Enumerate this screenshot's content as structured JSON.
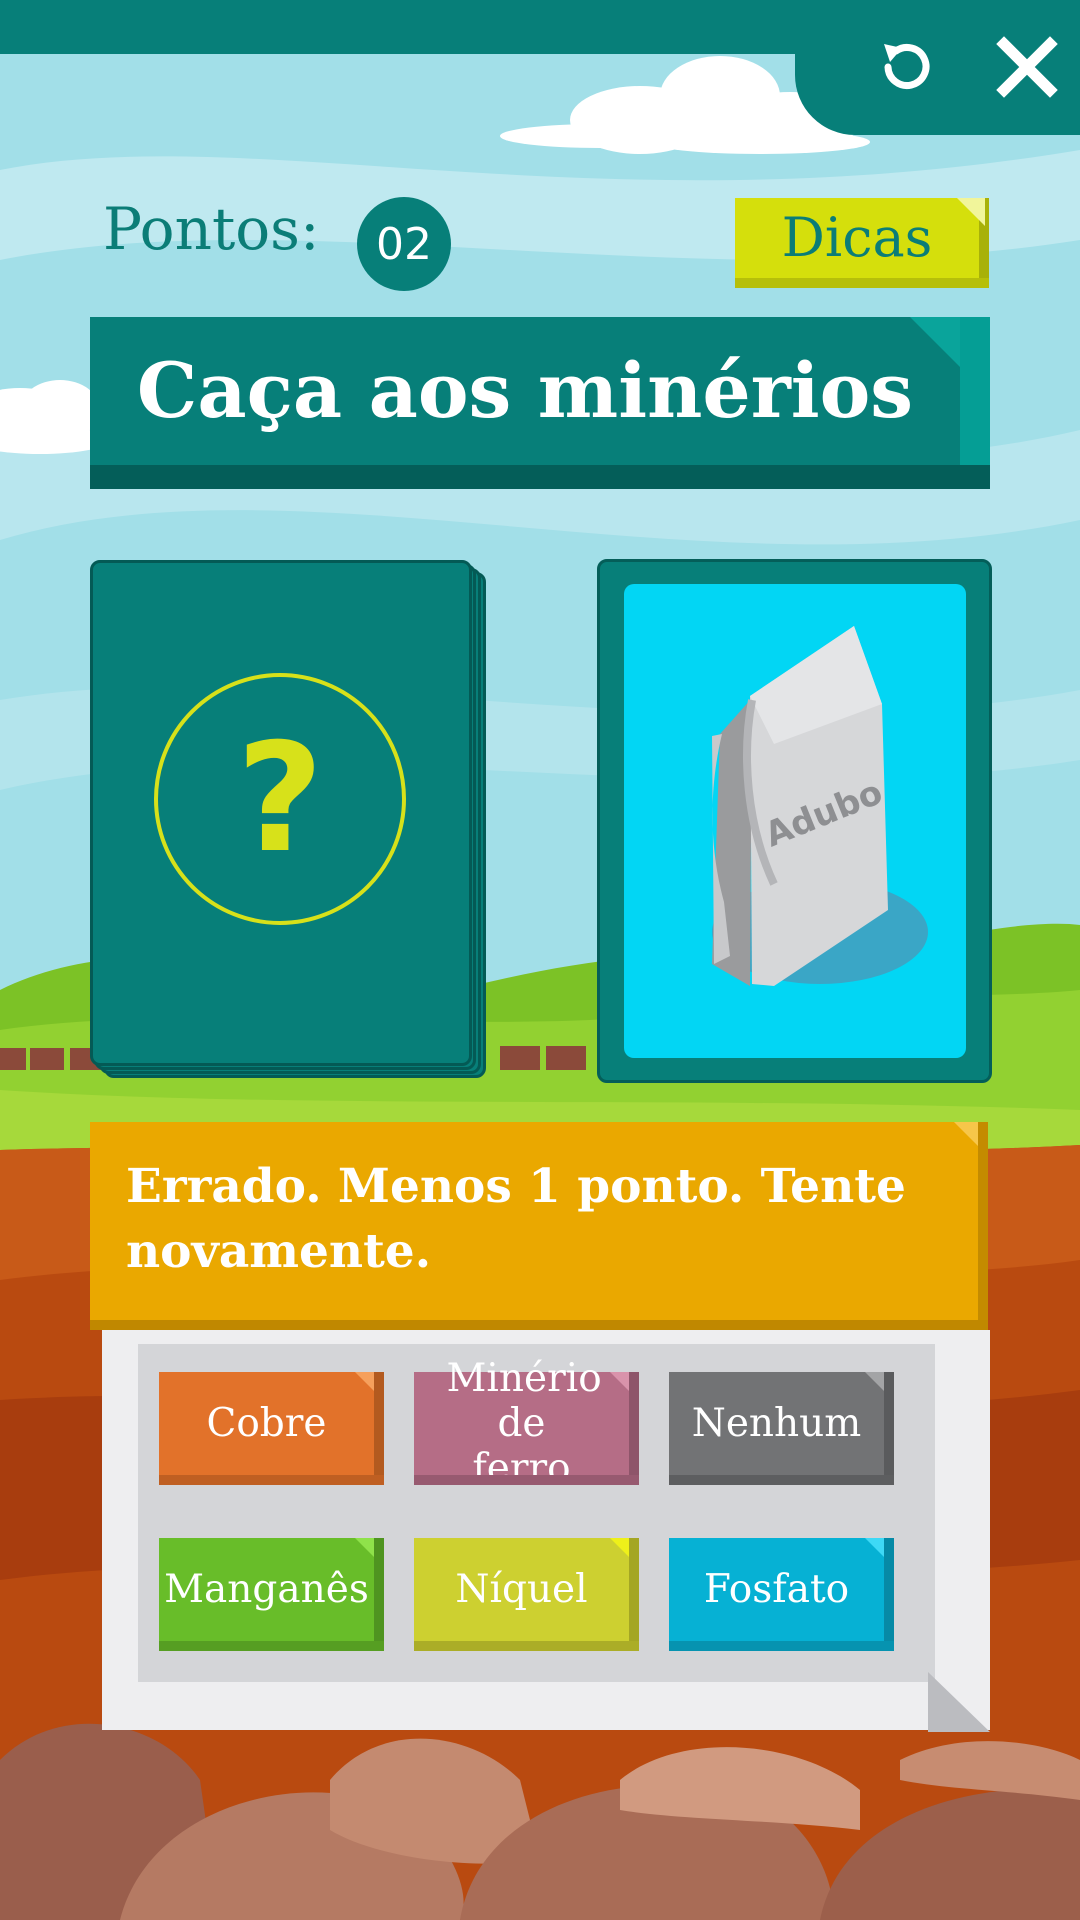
{
  "game": {
    "title": "Caça aos minérios",
    "score_label": "Pontos:",
    "score_value": "02",
    "tips_label": "Dicas"
  },
  "controls": {
    "restart_icon": "restart-icon",
    "close_icon": "close-icon"
  },
  "cards": {
    "deck_symbol": "?",
    "shown_item_label": "Adubo"
  },
  "feedback": {
    "message": "Errado. Menos 1 ponto. Tente novamente."
  },
  "answers": [
    {
      "label": "Cobre",
      "color": "#e2722a"
    },
    {
      "label": "Minério de ferro",
      "color": "#b56d86"
    },
    {
      "label": "Nenhum",
      "color": "#727375"
    },
    {
      "label": "Manganês",
      "color": "#68bd29"
    },
    {
      "label": "Níquel",
      "color": "#cdd030"
    },
    {
      "label": "Fosfato",
      "color": "#06b1d4"
    }
  ],
  "colors": {
    "brand_teal": "#077f79",
    "tips_yellow": "#d5df0c",
    "feedback_orange": "#eaa800",
    "card_face_cyan": "#02d6f4"
  }
}
